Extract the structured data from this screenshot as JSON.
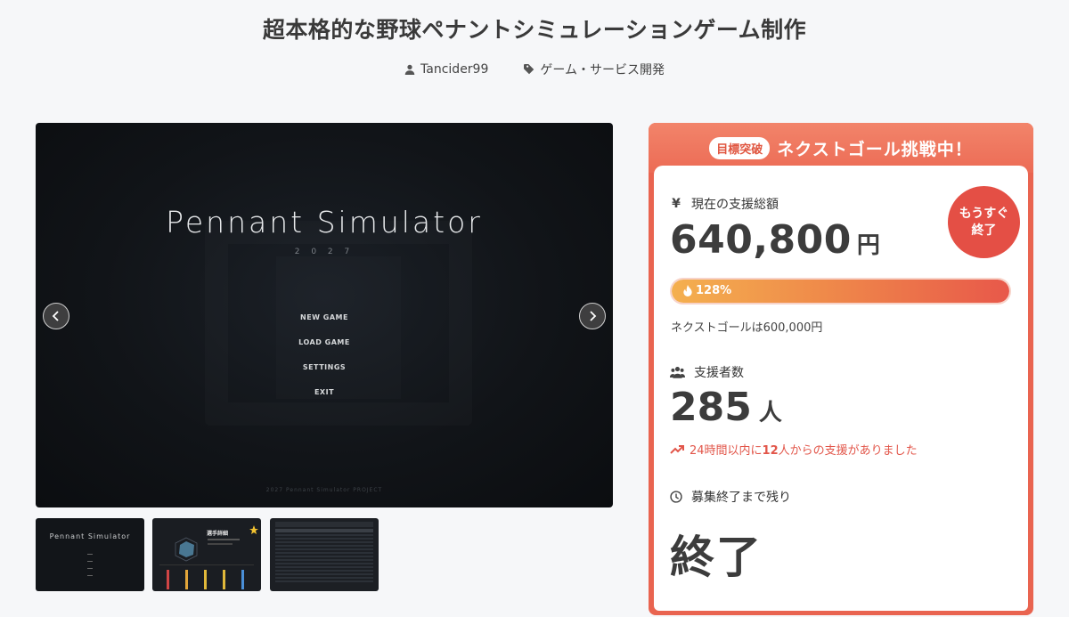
{
  "page": {
    "title": "超本格的な野球ペナントシミュレーションゲーム制作",
    "author": "Tancider99",
    "category": "ゲーム・サービス開発"
  },
  "hero": {
    "game_title": "Pennant Simulator",
    "year": "2 0 2 7",
    "menu": [
      "NEW GAME",
      "LOAD GAME",
      "SETTINGS",
      "EXIT"
    ],
    "copyright": "2027 Pennant Simulator PROJECT"
  },
  "thumbnails": {
    "t1_title": "Pennant Simulator",
    "t2_title": "選手詳細"
  },
  "funding": {
    "banner_badge": "目標突破",
    "banner_text": "ネクストゴール挑戦中！",
    "amount_label": "現在の支援総額",
    "amount": "640,800",
    "amount_unit": "円",
    "ending_badge_line1": "もうすぐ",
    "ending_badge_line2": "終了",
    "progress_percent": 128,
    "progress_label": "128%",
    "next_goal_text": "ネクストゴールは600,000円",
    "backers_label": "支援者数",
    "backers": "285",
    "backers_unit": "人",
    "trend_prefix": "24時間以内に",
    "trend_count": "12",
    "trend_suffix": "人からの支援がありました",
    "remaining_label": "募集終了まで残り",
    "remaining_value": "終了"
  },
  "colors": {
    "accent": "#e96450",
    "badge": "#e44f45",
    "trend": "#e2564a"
  },
  "icons": {
    "author": "user-icon",
    "category": "tag-icon",
    "amount": "yen-icon",
    "backers": "users-icon",
    "trend": "trending-up-icon",
    "remaining": "clock-icon",
    "progress": "fire-icon"
  }
}
